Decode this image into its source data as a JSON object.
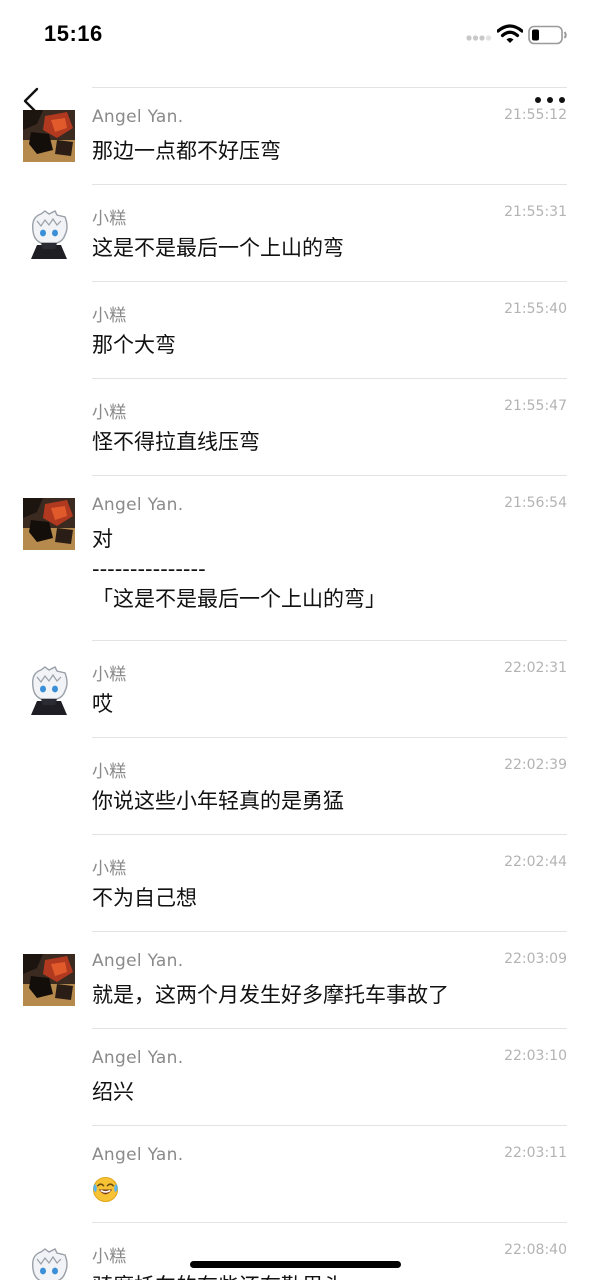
{
  "status_bar": {
    "time": "15:16"
  },
  "header": {
    "back_icon": "chevron-left-icon",
    "more_icon": "ellipsis-icon"
  },
  "messages": [
    {
      "sender": "Angel Yan.",
      "time": "21:55:12",
      "lines": [
        "那边一点都不好压弯"
      ],
      "avatar": "angel"
    },
    {
      "sender": "小糕",
      "time": "21:55:31",
      "lines": [
        "这是不是最后一个上山的弯"
      ],
      "avatar": "xiaogao"
    },
    {
      "sender": "小糕",
      "time": "21:55:40",
      "lines": [
        "那个大弯"
      ],
      "avatar": ""
    },
    {
      "sender": "小糕",
      "time": "21:55:47",
      "lines": [
        "怪不得拉直线压弯"
      ],
      "avatar": ""
    },
    {
      "sender": "Angel Yan.",
      "time": "21:56:54",
      "lines": [
        "对",
        "---------------",
        "「这是不是最后一个上山的弯」"
      ],
      "avatar": "angel"
    },
    {
      "sender": "小糕",
      "time": "22:02:31",
      "lines": [
        "哎"
      ],
      "avatar": "xiaogao"
    },
    {
      "sender": "小糕",
      "time": "22:02:39",
      "lines": [
        "你说这些小年轻真的是勇猛"
      ],
      "avatar": ""
    },
    {
      "sender": "小糕",
      "time": "22:02:44",
      "lines": [
        "不为自己想"
      ],
      "avatar": ""
    },
    {
      "sender": "Angel Yan.",
      "time": "22:03:09",
      "lines": [
        "就是，这两个月发生好多摩托车事故了"
      ],
      "avatar": "angel"
    },
    {
      "sender": "Angel Yan.",
      "time": "22:03:10",
      "lines": [
        "绍兴"
      ],
      "avatar": ""
    },
    {
      "sender": "Angel Yan.",
      "time": "22:03:11",
      "lines": [],
      "emoji": "laughing-crying-emoji-icon",
      "avatar": ""
    },
    {
      "sender": "小糕",
      "time": "22:08:40",
      "lines": [
        "骑摩托车的有些还有勤里头"
      ],
      "avatar": "xiaogao"
    }
  ]
}
